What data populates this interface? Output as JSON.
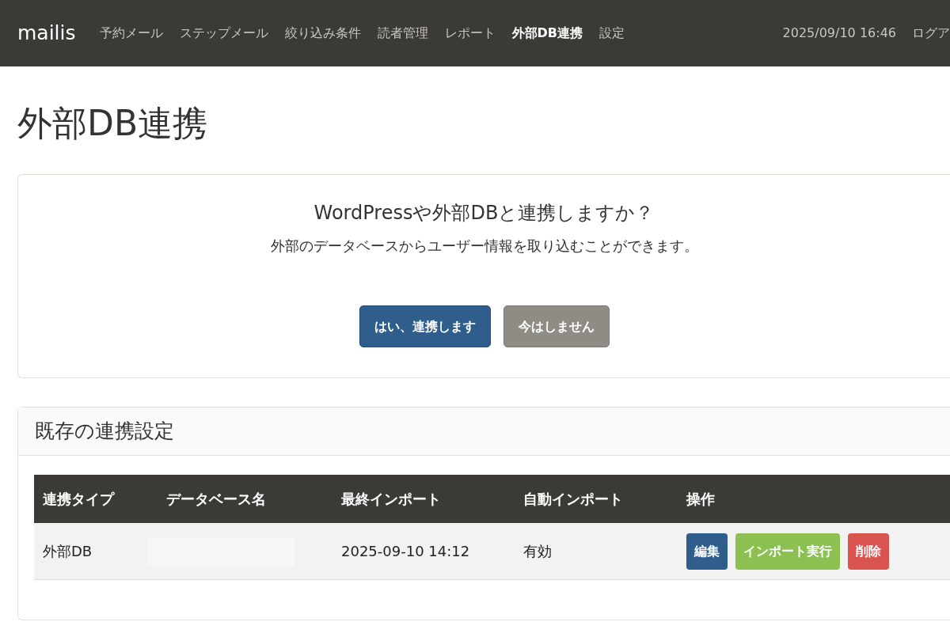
{
  "navbar": {
    "brand": "mailis",
    "items": [
      {
        "label": "予約メール",
        "selected": false
      },
      {
        "label": "ステップメール",
        "selected": false
      },
      {
        "label": "絞り込み条件",
        "selected": false
      },
      {
        "label": "読者管理",
        "selected": false
      },
      {
        "label": "レポート",
        "selected": false
      },
      {
        "label": "外部DB連携",
        "selected": true
      },
      {
        "label": "設定",
        "selected": false
      }
    ],
    "datetime": "2025/09/10 16:46",
    "logout": "ログア"
  },
  "page_title": "外部DB連携",
  "prompt_card": {
    "heading": "WordPressや外部DBと連携しますか？",
    "description": "外部のデータベースからユーザー情報を取り込むことができます。",
    "buttons": [
      {
        "label": "はい、連携します",
        "kind": "primary"
      },
      {
        "label": "今はしません",
        "kind": "secondary"
      }
    ]
  },
  "settings_card": {
    "title": "既存の連携設定",
    "table": {
      "columns": [
        "連携タイプ",
        "データベース名",
        "最終インポート",
        "自動インポート",
        "操作"
      ],
      "rows": [
        {
          "type": "外部DB",
          "database_redacted": true,
          "last_import": "2025-09-10 14:12",
          "auto_import": "有効",
          "actions": [
            {
              "label": "編集",
              "kind": "edit"
            },
            {
              "label": "インポート実行",
              "kind": "import"
            },
            {
              "label": "削除",
              "kind": "delete"
            }
          ]
        }
      ]
    }
  }
}
